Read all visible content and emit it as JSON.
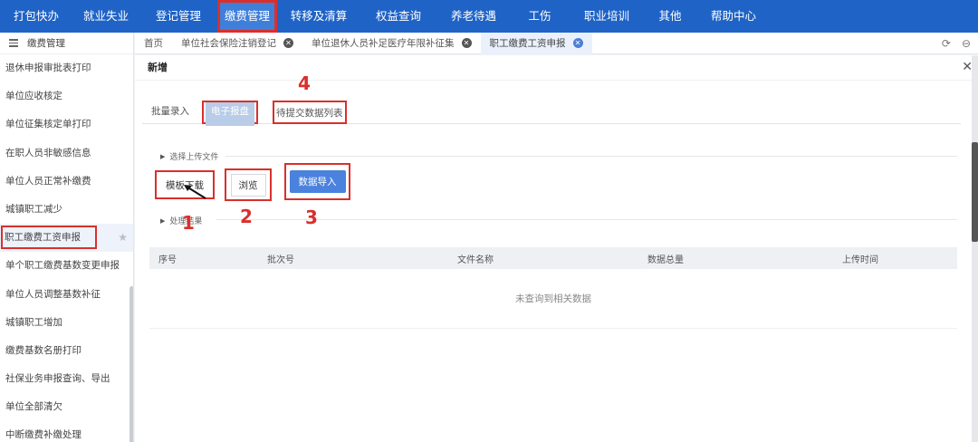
{
  "topnav": {
    "items": [
      "打包快办",
      "就业失业",
      "登记管理",
      "缴费管理",
      "转移及清算",
      "权益查询",
      "养老待遇",
      "工伤",
      "职业培训",
      "其他",
      "帮助中心"
    ],
    "active_index": 3
  },
  "sidebar": {
    "header": "缴费管理",
    "items": [
      "退休申报审批表打印",
      "单位应收核定",
      "单位征集核定单打印",
      "在职人员非敏感信息",
      "单位人员正常补缴费",
      "城镇职工减少",
      "职工缴费工资申报",
      "单个职工缴费基数变更申报",
      "单位人员调整基数补征",
      "城镇职工增加",
      "缴费基数名册打印",
      "社保业务申报查询、导出",
      "单位全部清欠",
      "中断缴费补缴处理"
    ],
    "active_index": 6
  },
  "tabs": [
    {
      "label": "首页",
      "closable": false
    },
    {
      "label": "单位社会保险注销登记",
      "closable": true
    },
    {
      "label": "单位退休人员补足医疗年限补征集",
      "closable": true
    },
    {
      "label": "职工缴费工资申报",
      "closable": true
    }
  ],
  "active_tab": 3,
  "panel": {
    "title": "新增",
    "subtabs": [
      "批量录入",
      "电子报盘",
      "待提交数据列表"
    ],
    "section_upload": "选择上传文件",
    "section_result": "处理结果",
    "buttons": {
      "template": "模板下载",
      "browse": "浏览",
      "import": "数据导入"
    },
    "table": {
      "columns": [
        "序号",
        "批次号",
        "文件名称",
        "数据总量",
        "上传时间"
      ],
      "empty_text": "未查询到相关数据"
    }
  },
  "annotations": [
    "1",
    "2",
    "3",
    "4"
  ],
  "colors": {
    "nav_bg": "#1f63c6",
    "annotation_red": "#d9302b",
    "primary_button": "#4a82de"
  }
}
